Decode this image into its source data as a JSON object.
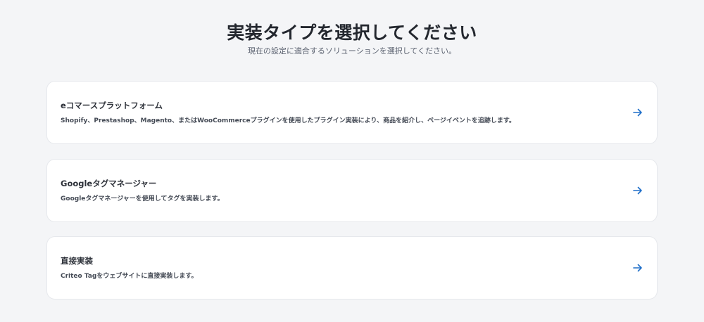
{
  "header": {
    "title": "実装タイプを選択してください",
    "subtitle": "現在の設定に適合するソリューションを選択してください。"
  },
  "options": [
    {
      "title": "eコマースプラットフォーム",
      "description": "Shopify、Prestashop、Magento、またはWooCommerceプラグインを使用したプラグイン実装により、商品を紹介し、ページイベントを追跡します。",
      "icon": "arrow-right-icon"
    },
    {
      "title": "Googleタグマネージャー",
      "description": "Googleタグマネージャーを使用してタグを実装します。",
      "icon": "arrow-right-icon"
    },
    {
      "title": "直接実装",
      "description": "Criteo Tagをウェブサイトに直接実装します。",
      "icon": "arrow-right-icon"
    }
  ],
  "colors": {
    "background": "#f4f5f7",
    "card": "#ffffff",
    "accent_arrow": "#1f6fc9"
  }
}
